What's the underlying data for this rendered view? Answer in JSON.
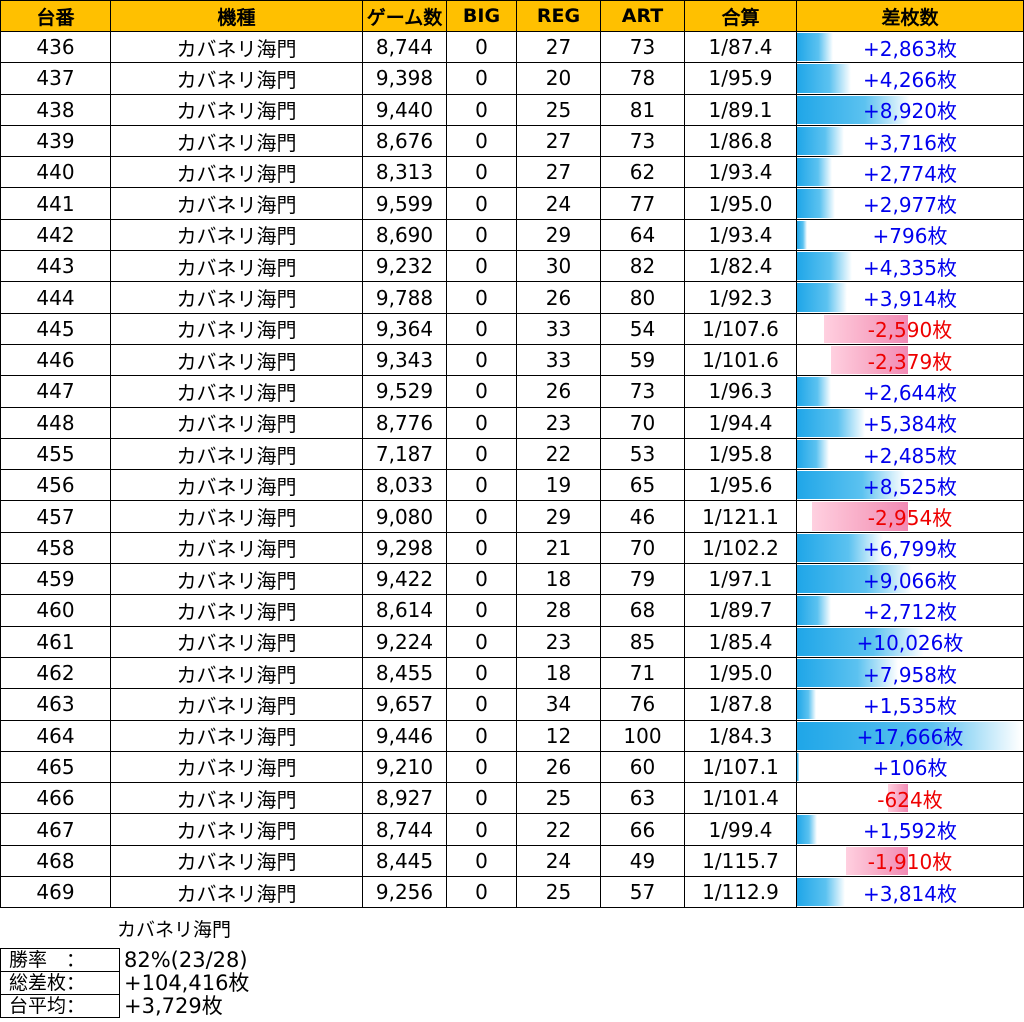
{
  "headers": [
    "台番",
    "機種",
    "ゲーム数",
    "BIG",
    "REG",
    "ART",
    "合算",
    "差枚数"
  ],
  "rows": [
    [
      "436",
      "カバネリ海門",
      "8,744",
      "0",
      "27",
      "73",
      "1/87.4",
      "+2,863枚",
      2863
    ],
    [
      "437",
      "カバネリ海門",
      "9,398",
      "0",
      "20",
      "78",
      "1/95.9",
      "+4,266枚",
      4266
    ],
    [
      "438",
      "カバネリ海門",
      "9,440",
      "0",
      "25",
      "81",
      "1/89.1",
      "+8,920枚",
      8920
    ],
    [
      "439",
      "カバネリ海門",
      "8,676",
      "0",
      "27",
      "73",
      "1/86.8",
      "+3,716枚",
      3716
    ],
    [
      "440",
      "カバネリ海門",
      "8,313",
      "0",
      "27",
      "62",
      "1/93.4",
      "+2,774枚",
      2774
    ],
    [
      "441",
      "カバネリ海門",
      "9,599",
      "0",
      "24",
      "77",
      "1/95.0",
      "+2,977枚",
      2977
    ],
    [
      "442",
      "カバネリ海門",
      "8,690",
      "0",
      "29",
      "64",
      "1/93.4",
      "+796枚",
      796
    ],
    [
      "443",
      "カバネリ海門",
      "9,232",
      "0",
      "30",
      "82",
      "1/82.4",
      "+4,335枚",
      4335
    ],
    [
      "444",
      "カバネリ海門",
      "9,788",
      "0",
      "26",
      "80",
      "1/92.3",
      "+3,914枚",
      3914
    ],
    [
      "445",
      "カバネリ海門",
      "9,364",
      "0",
      "33",
      "54",
      "1/107.6",
      "-2,590枚",
      -2590
    ],
    [
      "446",
      "カバネリ海門",
      "9,343",
      "0",
      "33",
      "59",
      "1/101.6",
      "-2,379枚",
      -2379
    ],
    [
      "447",
      "カバネリ海門",
      "9,529",
      "0",
      "26",
      "73",
      "1/96.3",
      "+2,644枚",
      2644
    ],
    [
      "448",
      "カバネリ海門",
      "8,776",
      "0",
      "23",
      "70",
      "1/94.4",
      "+5,384枚",
      5384
    ],
    [
      "455",
      "カバネリ海門",
      "7,187",
      "0",
      "22",
      "53",
      "1/95.8",
      "+2,485枚",
      2485
    ],
    [
      "456",
      "カバネリ海門",
      "8,033",
      "0",
      "19",
      "65",
      "1/95.6",
      "+8,525枚",
      8525
    ],
    [
      "457",
      "カバネリ海門",
      "9,080",
      "0",
      "29",
      "46",
      "1/121.1",
      "-2,954枚",
      -2954
    ],
    [
      "458",
      "カバネリ海門",
      "9,298",
      "0",
      "21",
      "70",
      "1/102.2",
      "+6,799枚",
      6799
    ],
    [
      "459",
      "カバネリ海門",
      "9,422",
      "0",
      "18",
      "79",
      "1/97.1",
      "+9,066枚",
      9066
    ],
    [
      "460",
      "カバネリ海門",
      "8,614",
      "0",
      "28",
      "68",
      "1/89.7",
      "+2,712枚",
      2712
    ],
    [
      "461",
      "カバネリ海門",
      "9,224",
      "0",
      "23",
      "85",
      "1/85.4",
      "+10,026枚",
      10026
    ],
    [
      "462",
      "カバネリ海門",
      "8,455",
      "0",
      "18",
      "71",
      "1/95.0",
      "+7,958枚",
      7958
    ],
    [
      "463",
      "カバネリ海門",
      "9,657",
      "0",
      "34",
      "76",
      "1/87.8",
      "+1,535枚",
      1535
    ],
    [
      "464",
      "カバネリ海門",
      "9,446",
      "0",
      "12",
      "100",
      "1/84.3",
      "+17,666枚",
      17666
    ],
    [
      "465",
      "カバネリ海門",
      "9,210",
      "0",
      "26",
      "60",
      "1/107.1",
      "+106枚",
      106
    ],
    [
      "466",
      "カバネリ海門",
      "8,927",
      "0",
      "25",
      "63",
      "1/101.4",
      "-624枚",
      -624
    ],
    [
      "467",
      "カバネリ海門",
      "8,744",
      "0",
      "22",
      "66",
      "1/99.4",
      "+1,592枚",
      1592
    ],
    [
      "468",
      "カバネリ海門",
      "8,445",
      "0",
      "24",
      "49",
      "1/115.7",
      "-1,910枚",
      -1910
    ],
    [
      "469",
      "カバネリ海門",
      "9,256",
      "0",
      "25",
      "57",
      "1/112.9",
      "+3,814枚",
      3814
    ]
  ],
  "summary": {
    "title": "カバネリ海門",
    "items": [
      {
        "label": "勝率　：",
        "value": "82%(23/28)"
      },
      {
        "label": "総差枚：",
        "value": "+104,416枚"
      },
      {
        "label": "台平均：",
        "value": "+3,729枚"
      }
    ]
  },
  "colors": {
    "header": "#FFC000",
    "positive_text": "#0000EE",
    "negative_text": "#EE0000",
    "positive_bar": "#1FA6E8",
    "negative_bar": "#F28AB5"
  }
}
